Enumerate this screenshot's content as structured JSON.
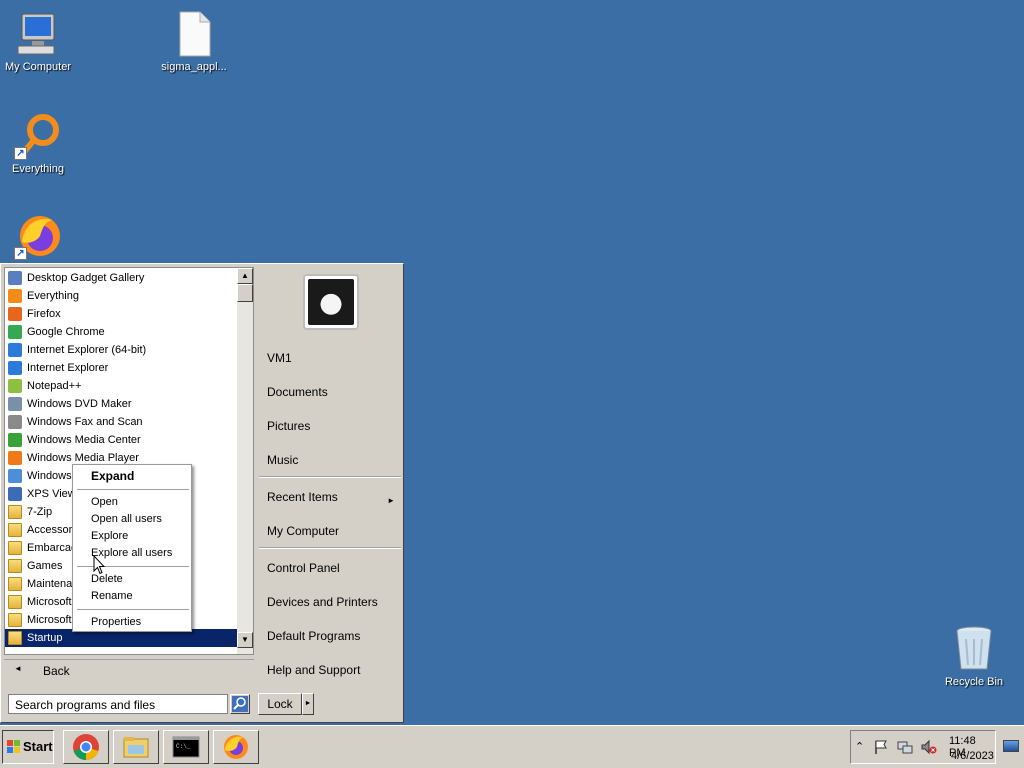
{
  "desktop": {
    "icons": [
      {
        "label": "My Computer",
        "icon": "computer-icon"
      },
      {
        "label": "sigma_appl...",
        "icon": "file-icon"
      },
      {
        "label": "Everything",
        "icon": "everything-icon"
      },
      {
        "label": "",
        "icon": "firefox-icon"
      },
      {
        "label": "Recycle Bin",
        "icon": "recycle-bin-icon"
      }
    ]
  },
  "start_menu": {
    "programs": [
      {
        "label": "Desktop Gadget Gallery",
        "icon": "gadget-icon",
        "color": "#5a7ec0"
      },
      {
        "label": "Everything",
        "icon": "everything-icon",
        "color": "#f28c1a"
      },
      {
        "label": "Firefox",
        "icon": "firefox-icon",
        "color": "#e8661c"
      },
      {
        "label": "Google Chrome",
        "icon": "chrome-icon",
        "color": "#34a853"
      },
      {
        "label": "Internet Explorer (64-bit)",
        "icon": "ie-icon",
        "color": "#2b7bd8"
      },
      {
        "label": "Internet Explorer",
        "icon": "ie-icon",
        "color": "#2b7bd8"
      },
      {
        "label": "Notepad++",
        "icon": "notepad-icon",
        "color": "#8fbf3f"
      },
      {
        "label": "Windows DVD Maker",
        "icon": "dvd-icon",
        "color": "#7b8fa8"
      },
      {
        "label": "Windows Fax and Scan",
        "icon": "fax-icon",
        "color": "#8a8a8a"
      },
      {
        "label": "Windows Media Center",
        "icon": "media-center-icon",
        "color": "#3aa13a"
      },
      {
        "label": "Windows Media Player",
        "icon": "media-player-icon",
        "color": "#f07a1a"
      },
      {
        "label": "Windows",
        "icon": "windows-update-icon",
        "color": "#4d8ed8"
      },
      {
        "label": "XPS Viewe",
        "icon": "xps-icon",
        "color": "#3c6bb8"
      },
      {
        "label": "7-Zip",
        "icon": "folder-icon",
        "folder": true
      },
      {
        "label": "Accessori",
        "icon": "folder-icon",
        "folder": true
      },
      {
        "label": "Embarcad",
        "icon": "folder-icon",
        "folder": true
      },
      {
        "label": "Games",
        "icon": "folder-icon",
        "folder": true
      },
      {
        "label": "Maintena",
        "icon": "folder-icon",
        "folder": true
      },
      {
        "label": "Microsoft",
        "icon": "folder-icon",
        "folder": true
      },
      {
        "label": "Microsoft",
        "icon": "folder-icon",
        "folder": true
      },
      {
        "label": "Startup",
        "icon": "folder-icon",
        "folder": true,
        "selected": true
      }
    ],
    "back_label": "Back",
    "search_placeholder": "Search programs and files",
    "right_items": {
      "user": "VM1",
      "documents": "Documents",
      "pictures": "Pictures",
      "music": "Music",
      "recent": "Recent Items",
      "computer": "My Computer",
      "control_panel": "Control Panel",
      "devices": "Devices and Printers",
      "default_programs": "Default Programs",
      "help": "Help and Support"
    },
    "lock_label": "Lock"
  },
  "context_menu": {
    "expand": "Expand",
    "open": "Open",
    "open_all_users": "Open all users",
    "explore": "Explore",
    "explore_all_users": "Explore all users",
    "delete": "Delete",
    "rename": "Rename",
    "properties": "Properties"
  },
  "taskbar": {
    "start_label": "Start",
    "pinned": [
      "chrome-icon",
      "explorer-icon",
      "cmd-icon",
      "firefox-icon"
    ],
    "time": "11:48 PM",
    "date": "4/6/2023"
  },
  "colors": {
    "desktop": "#3a6ea5",
    "selection": "#0a246a",
    "face": "#d4d0c8"
  }
}
